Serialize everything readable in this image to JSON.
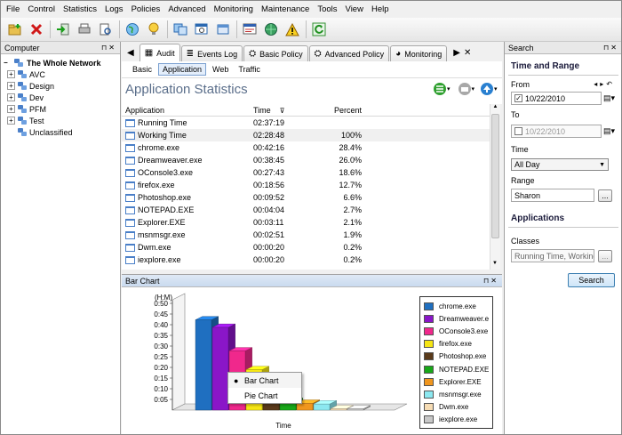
{
  "menu": [
    "File",
    "Control",
    "Statistics",
    "Logs",
    "Policies",
    "Advanced",
    "Monitoring",
    "Maintenance",
    "Tools",
    "View",
    "Help"
  ],
  "toolbar_icons": [
    "new-folder-icon",
    "delete-icon",
    "login-icon",
    "print-icon",
    "print-preview-icon",
    "globe-icon",
    "idea-icon",
    "copy-icon",
    "search-window-icon",
    "window-icon",
    "network-icon",
    "globe-network-icon",
    "warning-icon",
    "refresh-icon"
  ],
  "left_panel": {
    "title": "Computer",
    "root": "The Whole Network",
    "groups": [
      "AVC",
      "Design",
      "Dev",
      "PFM",
      "Test",
      "Unclassified"
    ]
  },
  "tabs": [
    {
      "label": "Audit",
      "icon": "audit-icon"
    },
    {
      "label": "Events Log",
      "icon": "events-log-icon"
    },
    {
      "label": "Basic Policy",
      "icon": "basic-policy-icon"
    },
    {
      "label": "Advanced Policy",
      "icon": "advanced-policy-icon"
    },
    {
      "label": "Monitoring",
      "icon": "monitoring-icon"
    }
  ],
  "subtabs": [
    "Basic",
    "Application",
    "Web",
    "Traffic"
  ],
  "stats": {
    "title": "Application Statistics",
    "headers": [
      "Application",
      "Time",
      "Percent"
    ],
    "rows": [
      {
        "app": "Running Time",
        "time": "02:37:19",
        "pct": ""
      },
      {
        "app": "Working Time",
        "time": "02:28:48",
        "pct": "100%"
      },
      {
        "app": "chrome.exe",
        "time": "00:42:16",
        "pct": "28.4%"
      },
      {
        "app": "Dreamweaver.exe",
        "time": "00:38:45",
        "pct": "26.0%"
      },
      {
        "app": "OConsole3.exe",
        "time": "00:27:43",
        "pct": "18.6%"
      },
      {
        "app": "firefox.exe",
        "time": "00:18:56",
        "pct": "12.7%"
      },
      {
        "app": "Photoshop.exe",
        "time": "00:09:52",
        "pct": "6.6%"
      },
      {
        "app": "NOTEPAD.EXE",
        "time": "00:04:04",
        "pct": "2.7%"
      },
      {
        "app": "Explorer.EXE",
        "time": "00:03:11",
        "pct": "2.1%"
      },
      {
        "app": "msnmsgr.exe",
        "time": "00:02:51",
        "pct": "1.9%"
      },
      {
        "app": "Dwm.exe",
        "time": "00:00:20",
        "pct": "0.2%"
      },
      {
        "app": "iexplore.exe",
        "time": "00:00:20",
        "pct": "0.2%"
      }
    ]
  },
  "chart_panel_title": "Bar Chart",
  "chart_data": {
    "type": "bar",
    "ylabel": "(H:M)",
    "xlabel": "Time",
    "ytick_labels": [
      "0:05",
      "0:10",
      "0:15",
      "0:20",
      "0:25",
      "0:30",
      "0:35",
      "0:40",
      "0:45",
      "0:50"
    ],
    "ylim_minutes": [
      0,
      50
    ],
    "categories": [
      "chrome.exe",
      "Dreamweaver.e",
      "OConsole3.exe",
      "firefox.exe",
      "Photoshop.exe",
      "NOTEPAD.EXE",
      "Explorer.EXE",
      "msnmsgr.exe",
      "Dwm.exe",
      "iexplore.exe"
    ],
    "values_minutes": [
      42.27,
      38.75,
      27.72,
      18.93,
      9.87,
      4.07,
      3.18,
      2.85,
      0.33,
      0.33
    ],
    "colors": [
      "#1f6fc0",
      "#8a16c8",
      "#f0288c",
      "#f6e614",
      "#5a3a1a",
      "#18a818",
      "#f0961e",
      "#8ce8f0",
      "#f6dcb4",
      "#c8c8c8"
    ],
    "legend_placement": "right",
    "grid": false
  },
  "context_menu": [
    {
      "label": "Bar Chart",
      "checked": true
    },
    {
      "label": "Pie Chart",
      "checked": false
    }
  ],
  "search_panel": {
    "title": "Search",
    "time_range_title": "Time and Range",
    "from_label": "From",
    "from_value": "10/22/2010",
    "to_label": "To",
    "to_value": "10/22/2010",
    "time_label": "Time",
    "time_value": "All Day",
    "range_label": "Range",
    "range_value": "Sharon",
    "applications_title": "Applications",
    "classes_label": "Classes",
    "classes_value": "Running Time, Working",
    "browse_label": "...",
    "search_button": "Search"
  }
}
